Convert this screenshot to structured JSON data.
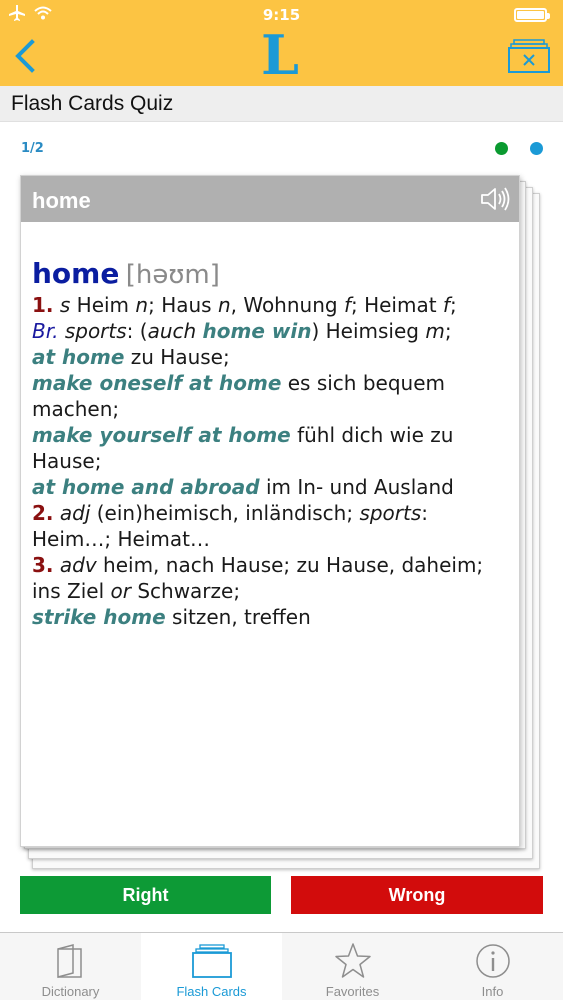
{
  "status": {
    "time": "9:15"
  },
  "header": {
    "logo": "L",
    "back_icon": "chevron-left-icon",
    "delete_icon": "delete-cards-icon"
  },
  "page_title": "Flash Cards Quiz",
  "progress": {
    "text": "1/2",
    "current": 1,
    "total": 2
  },
  "indicator_colors": [
    "#0a9a30",
    "#1b9ad6"
  ],
  "card": {
    "header_word": "home",
    "speaker_icon": "speaker-icon",
    "entry": {
      "headword": "home",
      "pronunciation": "[həʊm]",
      "n1": "1.",
      "pos1": "s",
      "t1a": " Heim ",
      "g1": "n",
      "t1b": "; Haus ",
      "g2": "n",
      "t1c": ", Wohnung ",
      "g3": "f",
      "t1d": "; Heimat ",
      "g4": "f",
      "t1e": ";",
      "label_br": "Br.",
      "label_sports": "sports",
      "t2a": ": (",
      "auch": "auch",
      "phrase_home_win": "home win",
      "t2b": ") Heimsieg ",
      "g5": "m",
      "t2c": ";",
      "phrase_at_home": "at home",
      "t3": " zu Hause;",
      "phrase_make_oneself": "make oneself at home",
      "t4": " es sich bequem machen;",
      "phrase_make_yourself": "make yourself at home",
      "t5": " fühl dich wie zu Hause;",
      "phrase_home_abroad": "at home and abroad",
      "t6": " im In- und Ausland",
      "n2": "2.",
      "pos2": "adj",
      "t7a": " (ein)heimisch, inländisch; ",
      "sports2": "sports",
      "t7b": ": Heim…; Heimat…",
      "n3": "3.",
      "pos3": "adv",
      "t8a": " heim, nach Hause; zu Hause, daheim; ins Ziel ",
      "or": "or",
      "t8b": " Schwarze;",
      "phrase_strike_home": "strike home",
      "t9": " sitzen, treffen"
    }
  },
  "buttons": {
    "right": "Right",
    "wrong": "Wrong"
  },
  "tabs": [
    {
      "label": "Dictionary",
      "icon": "book-icon"
    },
    {
      "label": "Flash Cards",
      "icon": "flash-cards-icon"
    },
    {
      "label": "Favorites",
      "icon": "star-icon"
    },
    {
      "label": "Info",
      "icon": "info-icon"
    }
  ],
  "colors": {
    "brand_yellow": "#fcc443",
    "accent_blue": "#1b9ad6",
    "right_green": "#0d9a36",
    "wrong_red": "#d20c0c"
  }
}
